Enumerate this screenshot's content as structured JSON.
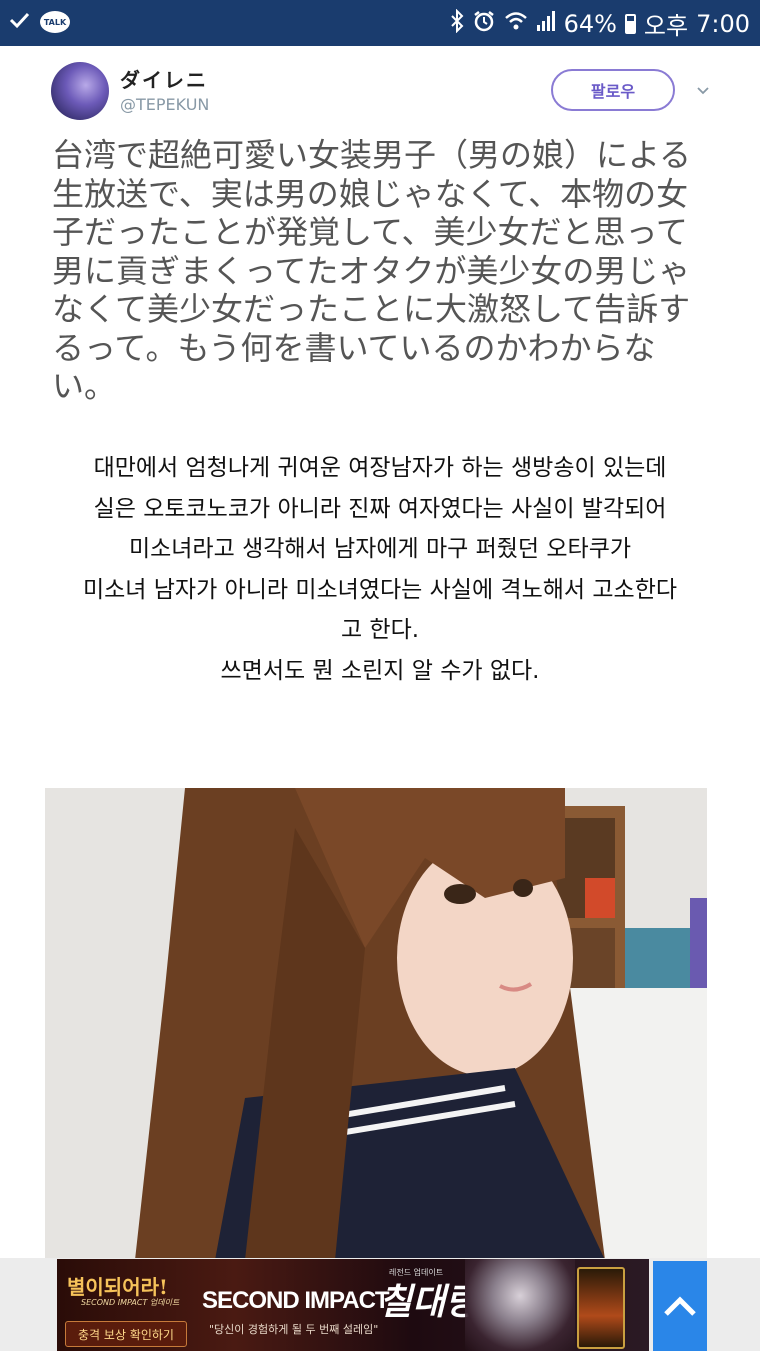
{
  "status_bar": {
    "talk_label": "TALK",
    "battery": "64%",
    "battery_level": 0.64,
    "ampm": "오후",
    "time": "7:00",
    "bg_color": "#1a3c6e",
    "icons": [
      "check-icon",
      "kakaotalk-icon",
      "bluetooth-icon",
      "alarm-icon",
      "wifi-icon",
      "signal-icon",
      "battery-icon"
    ]
  },
  "tweet": {
    "display_name": "ダイレニ",
    "handle": "@TEPEKUN",
    "follow_label": "팔로우",
    "text": "台湾で超絶可愛い女装男子（男の娘）による生放送で、実は男の娘じゃなくて、本物の女子だったことが発覚して、美少女だと思って男に貢ぎまくってたオタクが美少女の男じゃなくて美少女だったことに大激怒して告訴するって。もう何を書いているのかわからない。"
  },
  "translation": {
    "lines": [
      "대만에서 엄청나게 귀여운 여장남자가 하는 생방송이 있는데",
      "실은 오토코노코가 아니라 진짜 여자였다는 사실이 발각되어",
      "미소녀라고 생각해서 남자에게 마구 퍼줬던 오타쿠가",
      "미소녀 남자가 아니라 미소녀였다는 사실에 격노해서 고소한다",
      "고 한다.",
      "쓰면서도 뭔 소린지 알 수가 없다."
    ]
  },
  "ad": {
    "logo": "별이되어라!",
    "logo_sub": "SECOND IMPACT 업데이트",
    "cta": "충격 보상 확인하기",
    "title": "SECOND IMPACT",
    "title_kr": "칠대랑",
    "mini": "레전드 업데이트",
    "tagline": "\"당신이 경험하게 될 두 번째 설레임\"",
    "accent": "#2a86e8"
  },
  "colors": {
    "follow_border": "#8a7bd4",
    "follow_text": "#6a5ac8",
    "handle": "#8899a6"
  }
}
